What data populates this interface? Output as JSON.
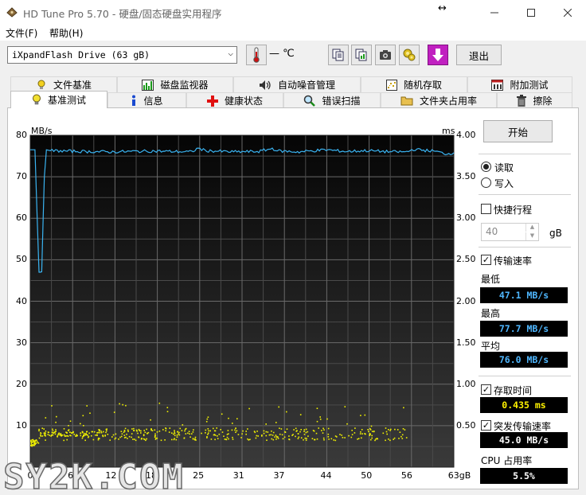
{
  "window": {
    "title": "HD Tune Pro 5.70 - 硬盘/固态硬盘实用程序",
    "resize_glyph": "↔"
  },
  "menu": {
    "file": "文件(F)",
    "help": "帮助(H)"
  },
  "toolbar": {
    "drive": "iXpandFlash Drive (63 gB)",
    "temperature": "— ℃",
    "exit_label": "退出"
  },
  "tabs_top": [
    {
      "label": "文件基准",
      "icon": "file-benchmark-icon"
    },
    {
      "label": "磁盘监视器",
      "icon": "disk-monitor-icon"
    },
    {
      "label": "自动噪音管理",
      "icon": "speaker-icon"
    },
    {
      "label": "随机存取",
      "icon": "random-access-icon"
    },
    {
      "label": "附加测试",
      "icon": "extra-tests-icon"
    }
  ],
  "tabs_bottom": [
    {
      "label": "基准测试",
      "icon": "lightbulb-icon",
      "active": true
    },
    {
      "label": "信息",
      "icon": "info-icon"
    },
    {
      "label": "健康状态",
      "icon": "health-cross-icon"
    },
    {
      "label": "错误扫描",
      "icon": "magnifier-icon"
    },
    {
      "label": "文件夹占用率",
      "icon": "folder-icon"
    },
    {
      "label": "擦除",
      "icon": "trash-icon"
    }
  ],
  "side": {
    "start_label": "开始",
    "read_label": "读取",
    "write_label": "写入",
    "short_stroke_label": "快捷行程",
    "short_stroke_value": "40",
    "short_stroke_unit": "gB",
    "transfer_rate_label": "传输速率",
    "min_label": "最低",
    "min_value": "47.1 MB/s",
    "max_label": "最高",
    "max_value": "77.7 MB/s",
    "avg_label": "平均",
    "avg_value": "76.0 MB/s",
    "access_time_label": "存取时间",
    "access_time_value": "0.435 ms",
    "burst_rate_label": "突发传输速率",
    "burst_rate_value": "45.0 MB/s",
    "cpu_label": "CPU 占用率",
    "cpu_value": "5.5%"
  },
  "watermark": "SY2K.COM",
  "chart_data": {
    "type": "line",
    "ylabel_left": "MB/s",
    "ylabel_right": "ms",
    "ylim_left": [
      0,
      80
    ],
    "ylim_right": [
      0,
      4
    ],
    "yticks_left": [
      "80",
      "70",
      "60",
      "50",
      "40",
      "30",
      "20",
      "10"
    ],
    "yticks_right": [
      "4.00",
      "3.50",
      "3.00",
      "2.50",
      "2.00",
      "1.50",
      "1.00",
      "0.50"
    ],
    "xlim": [
      0,
      63
    ],
    "xticks": [
      "0",
      "6",
      "12",
      "18",
      "25",
      "31",
      "37",
      "44",
      "50",
      "56",
      "63gB"
    ],
    "grid": true,
    "colors": {
      "transfer": "#3ab4f2",
      "access": "#f2f200"
    },
    "series": [
      {
        "x": [
          0,
          0.7,
          1.3,
          1.5,
          1.7,
          2.1,
          2.4,
          3,
          5,
          8,
          12,
          18,
          24,
          25,
          26,
          30,
          34,
          36,
          37,
          40,
          44,
          47,
          50,
          54,
          56,
          57,
          60,
          62,
          63
        ],
        "values": [
          76.5,
          76.5,
          47,
          47,
          47.1,
          70,
          76.5,
          76.3,
          76.2,
          76.1,
          76.0,
          76.2,
          76.0,
          76.9,
          76.3,
          76.0,
          76.1,
          76.8,
          76.2,
          76.0,
          76.5,
          76.1,
          76.3,
          76.0,
          76.0,
          76.6,
          76.2,
          75.5,
          75.8
        ]
      }
    ],
    "access_time_ms": {
      "typical_range": [
        0.33,
        0.48
      ],
      "outliers_max": 0.78,
      "average": 0.435
    }
  }
}
